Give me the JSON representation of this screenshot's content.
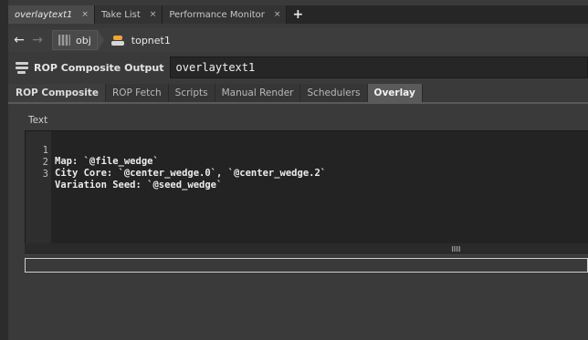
{
  "tabs": [
    {
      "label": "overlaytext1",
      "close": "×",
      "active": true
    },
    {
      "label": "Take List",
      "close": "×",
      "active": false
    },
    {
      "label": "Performance Monitor",
      "close": "×",
      "active": false
    }
  ],
  "add_tab_glyph": "+",
  "path": {
    "back_glyph": "←",
    "forward_glyph": "→",
    "crumbs": [
      {
        "label": "obj",
        "icon": "subnet-icon"
      },
      {
        "label": "topnet1",
        "icon": "topnet-icon"
      }
    ]
  },
  "node": {
    "icon": "rop-icon",
    "type_label": "ROP Composite Output",
    "name": "overlaytext1"
  },
  "parm_tabs": [
    "ROP Composite",
    "ROP Fetch",
    "Scripts",
    "Manual Render",
    "Schedulers",
    "Overlay"
  ],
  "active_parm_tab": "Overlay",
  "text_parm": {
    "label": "Text",
    "lines": [
      {
        "num": "1",
        "code": "Map: `@file_wedge`"
      },
      {
        "num": "2",
        "code": "City Core: `@center_wedge.0`, `@center_wedge.2`"
      },
      {
        "num": "3",
        "code": "Variation Seed: `@seed_wedge`"
      }
    ]
  },
  "colors": {
    "accent_orange": "#f0a630",
    "editor_bg": "#232323",
    "panel_bg": "#3a3a3a"
  }
}
